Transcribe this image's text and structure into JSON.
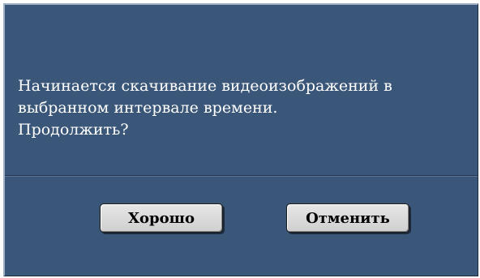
{
  "dialog": {
    "message_lines": [
      "Начинается скачивание видеоизображений в",
      "выбранном интервале времени.",
      "Продолжить?"
    ],
    "buttons": {
      "ok_label": "Хорошо",
      "cancel_label": "Отменить"
    },
    "colors": {
      "background": "#3a5678",
      "text": "#ffffff",
      "button_face": "#dcdcdc"
    }
  }
}
